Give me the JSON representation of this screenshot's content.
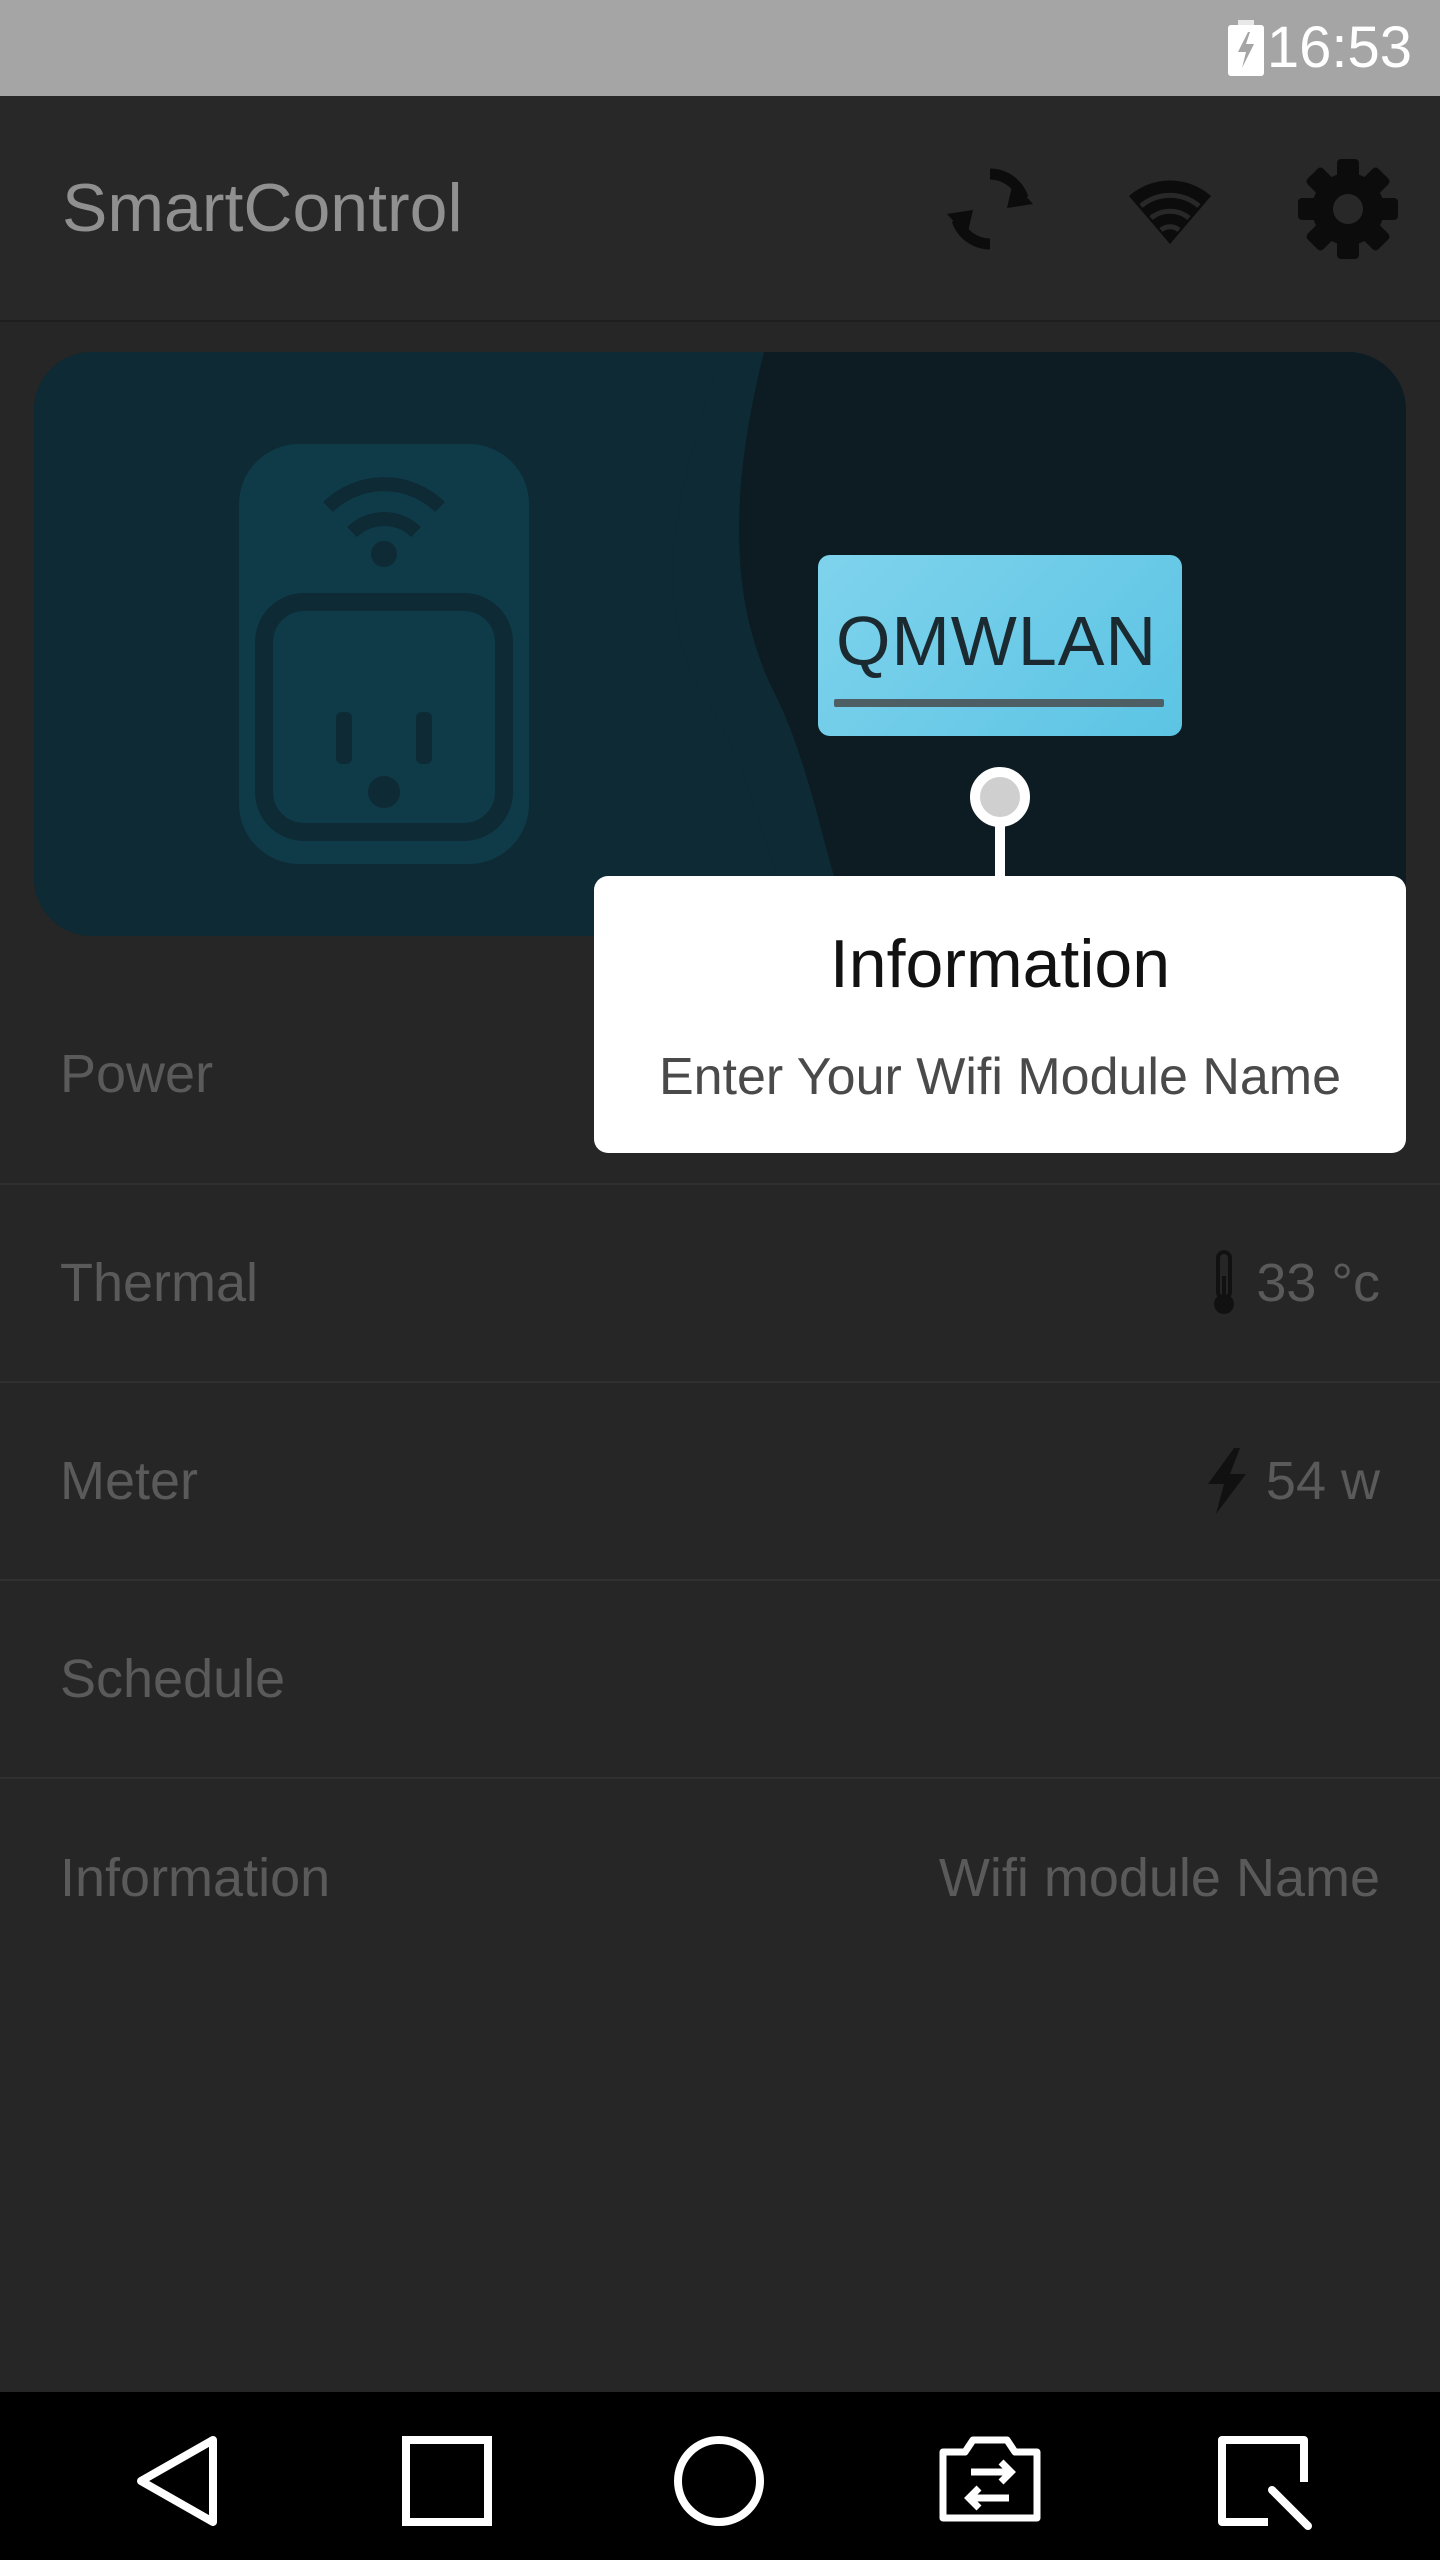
{
  "status_bar": {
    "time": "16:53",
    "battery_icon": "battery-charging-icon"
  },
  "app_bar": {
    "title": "SmartControl",
    "actions": [
      "refresh-icon",
      "wifi-icon",
      "gear-icon"
    ]
  },
  "hero": {
    "image": "smart-plug-wifi-illustration"
  },
  "list": {
    "rows": [
      {
        "label": "Power",
        "value": ""
      },
      {
        "label": "Thermal",
        "value": "33 °c",
        "icon": "thermometer-icon"
      },
      {
        "label": "Meter",
        "value": "54 w",
        "icon": "lightning-icon"
      },
      {
        "label": "Schedule",
        "value": ""
      },
      {
        "label": "Information",
        "value": "Wifi module Name"
      }
    ]
  },
  "highlight": {
    "value": "QMWLAN"
  },
  "tooltip": {
    "title": "Information",
    "message": "Enter Your Wifi Module Name"
  },
  "colors": {
    "accent": "#5cc4e4",
    "overlay_background": "#262626",
    "status_bar": "#a5a5a5"
  },
  "nav_bar": {
    "buttons": [
      "back-icon",
      "recent-apps-icon",
      "home-icon",
      "switch-app-icon",
      "screen-capture-icon"
    ]
  }
}
